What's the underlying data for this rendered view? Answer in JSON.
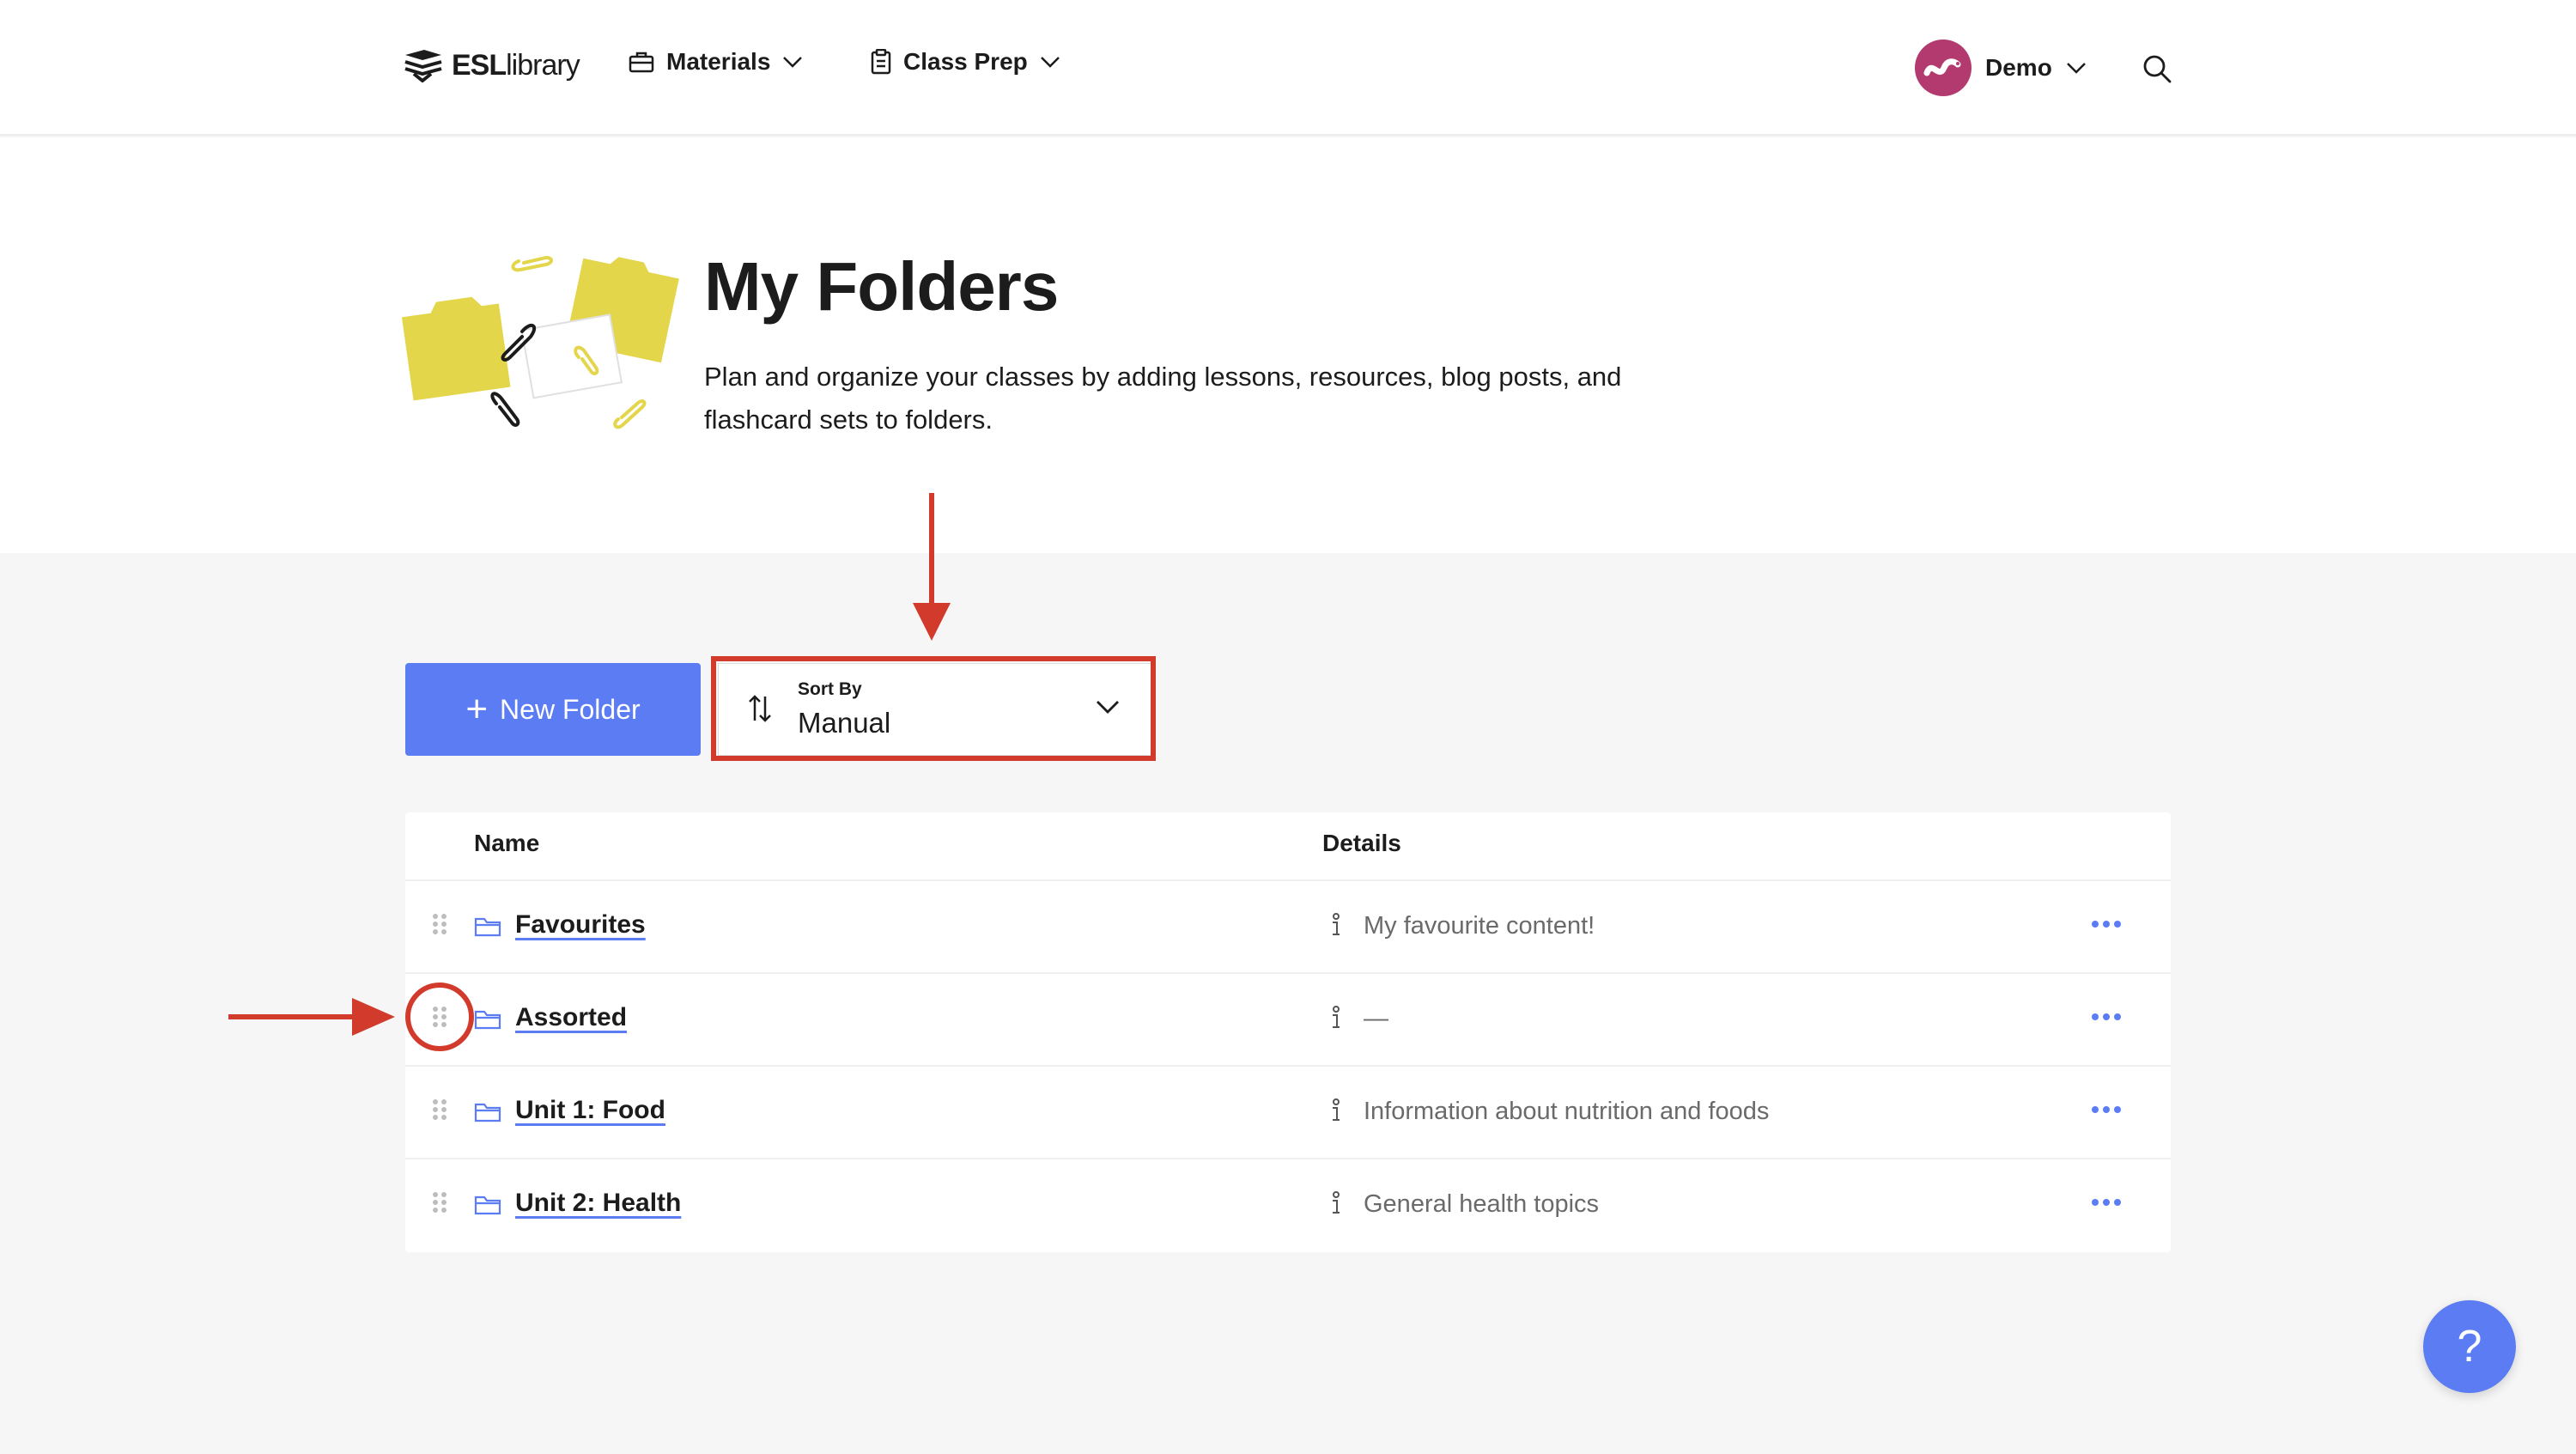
{
  "header": {
    "logo_bold": "ESL",
    "logo_light": "library",
    "nav": [
      {
        "label": "Materials",
        "icon": "briefcase-icon"
      },
      {
        "label": "Class Prep",
        "icon": "clipboard-icon"
      }
    ],
    "user_name": "Demo"
  },
  "hero": {
    "title": "My Folders",
    "description": "Plan and organize your classes by adding lessons, resources, blog posts, and flashcard sets to folders."
  },
  "toolbar": {
    "new_folder_label": "New Folder",
    "sort_label": "Sort By",
    "sort_value": "Manual"
  },
  "table": {
    "columns": [
      "Name",
      "Details"
    ],
    "rows": [
      {
        "name": "Favourites",
        "details": "My favourite content!"
      },
      {
        "name": "Assorted",
        "details": "—"
      },
      {
        "name": "Unit 1: Food",
        "details": "Information about nutrition and foods"
      },
      {
        "name": "Unit 2: Health",
        "details": "General health topics"
      }
    ]
  },
  "help_label": "?",
  "colors": {
    "accent": "#5b7cf2",
    "annotation": "#d23a2b",
    "folder_yellow": "#e4d64b"
  }
}
